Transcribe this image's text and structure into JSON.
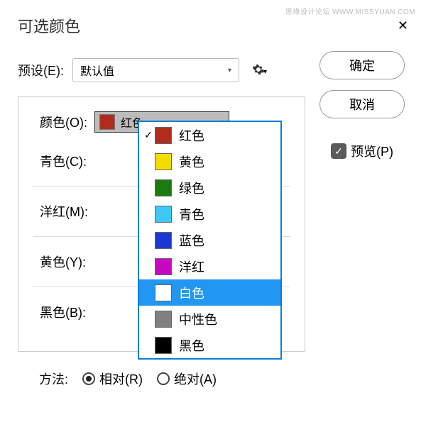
{
  "watermark": "思缘设计论坛 WWW.MISSYUAN.COM",
  "title": "可选颜色",
  "preset": {
    "label": "预设(E):",
    "value": "默认值"
  },
  "buttons": {
    "ok": "确定",
    "cancel": "取消"
  },
  "preview": {
    "label": "预览(P)",
    "checked": true
  },
  "color": {
    "label": "颜色(O):",
    "selected_label": "红色",
    "selected_swatch": "#b02d1d"
  },
  "sliders": [
    {
      "label": "青色(C):"
    },
    {
      "label": "洋红(M):"
    },
    {
      "label": "黄色(Y):"
    },
    {
      "label": "黑色(B):"
    }
  ],
  "method": {
    "label": "方法:",
    "relative": "相对(R)",
    "absolute": "绝对(A)",
    "selected": "relative"
  },
  "dropdown_items": [
    {
      "label": "红色",
      "color": "#b02d1d",
      "checked": true,
      "selected": false
    },
    {
      "label": "黄色",
      "color": "#f5dc00",
      "checked": false,
      "selected": false
    },
    {
      "label": "绿色",
      "color": "#1a7b0f",
      "checked": false,
      "selected": false
    },
    {
      "label": "青色",
      "color": "#3ec8f4",
      "checked": false,
      "selected": false
    },
    {
      "label": "蓝色",
      "color": "#1a39d4",
      "checked": false,
      "selected": false
    },
    {
      "label": "洋红",
      "color": "#c708c1",
      "checked": false,
      "selected": false
    },
    {
      "label": "白色",
      "color": "#ffffff",
      "checked": false,
      "selected": true
    },
    {
      "label": "中性色",
      "color": "#808080",
      "checked": false,
      "selected": false
    },
    {
      "label": "黑色",
      "color": "#000000",
      "checked": false,
      "selected": false
    }
  ]
}
